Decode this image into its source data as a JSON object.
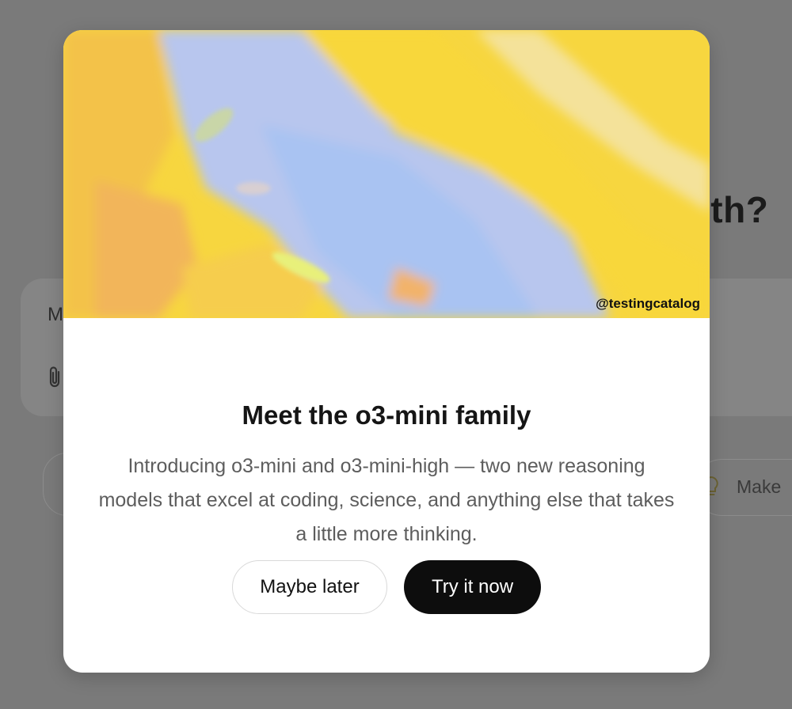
{
  "background": {
    "heading_fragment": "ith?",
    "composer_placeholder_fragment": "M",
    "suggestion_chip_label": "Make"
  },
  "modal": {
    "hero_credit": "@testingcatalog",
    "title": "Meet the o3-mini family",
    "description": "Introducing o3-mini and o3-mini-high — two new reasoning models that excel at coding, science, and anything else that takes a little more thinking.",
    "buttons": {
      "maybe_later": "Maybe later",
      "try_it_now": "Try it now"
    }
  },
  "icons": {
    "attach": "paperclip-icon",
    "suggestion": "lightbulb-icon"
  },
  "colors": {
    "overlay": "#7a7a7a",
    "modal_bg": "#ffffff",
    "hero_yellow": "#f6d53c",
    "hero_blue": "#b9c8ef",
    "primary_button": "#0d0d0d",
    "primary_button_text": "#ffffff",
    "secondary_button_border": "#d9d9d9",
    "description_text": "#5d5d5d"
  }
}
